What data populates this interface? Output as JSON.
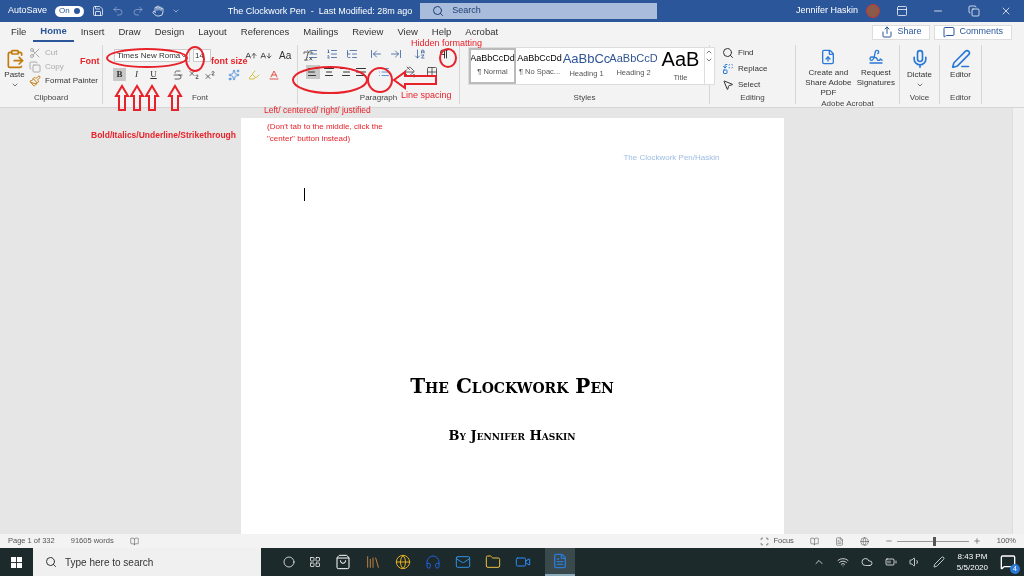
{
  "title_bar": {
    "autosave_label": "AutoSave",
    "autosave_state": "On",
    "autosave_on": true,
    "document_title": "The Clockwork Pen  -  Last Modified: 28m ago",
    "search": {
      "placeholder": "Search"
    },
    "user_name": "Jennifer Haskin"
  },
  "ribbon_tabs": [
    {
      "label": "File",
      "selected": false
    },
    {
      "label": "Home",
      "selected": true
    },
    {
      "label": "Insert",
      "selected": false
    },
    {
      "label": "Draw",
      "selected": false
    },
    {
      "label": "Design",
      "selected": false
    },
    {
      "label": "Layout",
      "selected": false
    },
    {
      "label": "References",
      "selected": false
    },
    {
      "label": "Mailings",
      "selected": false
    },
    {
      "label": "Review",
      "selected": false
    },
    {
      "label": "View",
      "selected": false
    },
    {
      "label": "Help",
      "selected": false
    },
    {
      "label": "Acrobat",
      "selected": false
    }
  ],
  "share_button": "Share",
  "comments_button": "Comments",
  "clipboard": {
    "label": "Clipboard",
    "paste": "Paste",
    "cut": {
      "label": "Cut",
      "disabled": true
    },
    "copy": {
      "label": "Copy",
      "disabled": true
    },
    "format_painter": "Format Painter"
  },
  "font": {
    "label": "Font",
    "font_name": "Times New Roma",
    "font_size": "14",
    "change_case": "Aa",
    "format_buttons": [
      {
        "label": "B",
        "kind": "bold",
        "selected": true
      },
      {
        "label": "I",
        "kind": "italic",
        "selected": false
      },
      {
        "label": "U",
        "kind": "underline",
        "selected": false
      }
    ]
  },
  "paragraph": {
    "label": "Paragraph",
    "alignments": [
      {
        "kind": "left",
        "selected": true
      },
      {
        "kind": "center",
        "selected": false
      },
      {
        "kind": "right",
        "selected": false
      },
      {
        "kind": "justify",
        "selected": false
      }
    ]
  },
  "styles": {
    "label": "Styles",
    "items": [
      {
        "preview": "AaBbCcDd",
        "name": "¶ Normal",
        "kind": "body",
        "selected": true
      },
      {
        "preview": "AaBbCcDd",
        "name": "¶ No Spac...",
        "kind": "body",
        "selected": false
      },
      {
        "preview": "AaBbCc",
        "name": "Heading 1",
        "kind": "heading1",
        "selected": false
      },
      {
        "preview": "AaBbCcD",
        "name": "Heading 2",
        "kind": "heading2",
        "selected": false
      },
      {
        "preview": "AaB",
        "name": "Title",
        "kind": "title",
        "selected": false
      }
    ]
  },
  "editing": {
    "label": "Editing",
    "find": "Find",
    "replace": "Replace",
    "select": "Select"
  },
  "adobe_acrobat": {
    "label": "Adobe Acrobat",
    "create_pdf": "Create and Share Adobe PDF",
    "request_signatures": "Request Signatures"
  },
  "voice": {
    "label": "Voice",
    "dictate": "Dictate"
  },
  "editor": {
    "label": "Editor",
    "button": "Editor"
  },
  "document": {
    "header": "The Clockwork Pen/Haskin",
    "title": "The Clockwork Pen",
    "byline": "By Jennifer Haskin"
  },
  "annotations": [
    {
      "text": "Font"
    },
    {
      "text": "font size"
    },
    {
      "text": "Hidden formatting"
    },
    {
      "text": "Line spacing"
    },
    {
      "text": "Left/ centered/ right/ justified"
    },
    {
      "text": "Bold/Italics/Underline/Strikethrough"
    },
    {
      "text": "(Don't tab to the middle, click the \"center\" button instead)"
    }
  ],
  "status_bar": {
    "page": "Page 1 of 332",
    "words": "91605 words",
    "focus": "Focus",
    "zoom": {
      "level": 0.5,
      "reading": "100%"
    }
  },
  "taskbar": {
    "search": {
      "placeholder": "Type here to search"
    },
    "time": "8:43 PM",
    "date": "5/5/2020",
    "notifications": "4"
  }
}
